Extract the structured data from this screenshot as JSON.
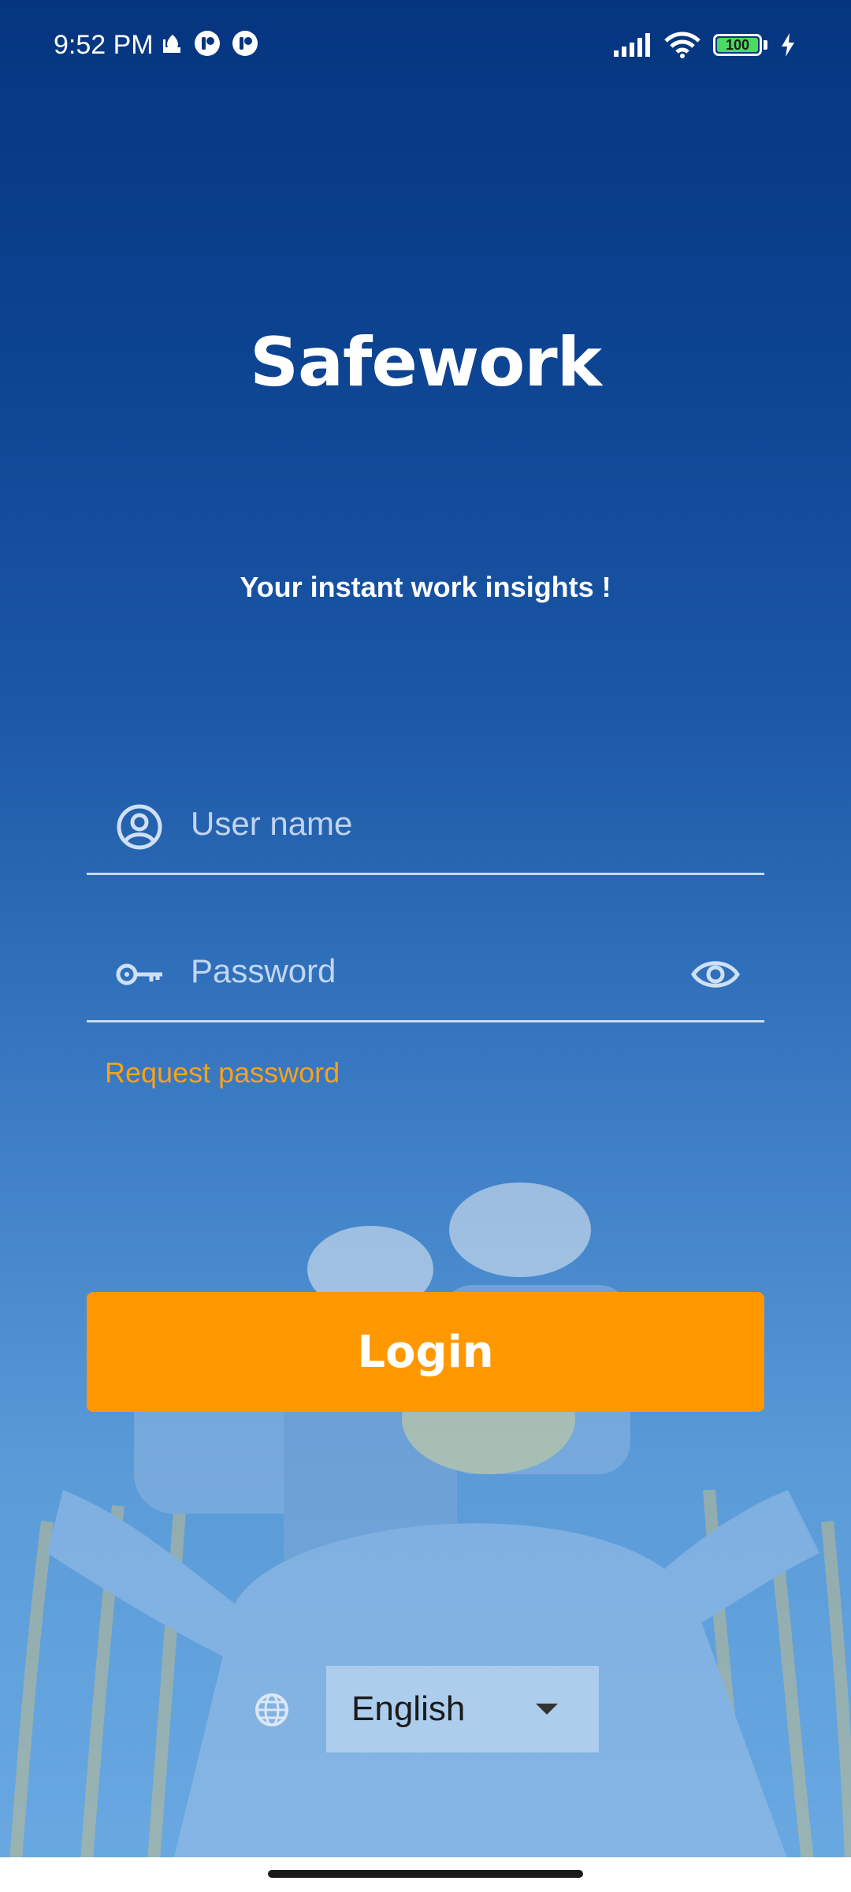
{
  "status_bar": {
    "time": "9:52 PM",
    "battery": "100",
    "icons": [
      "mosque-icon",
      "app-notification-icon",
      "app-notification-icon",
      "signal-icon",
      "wifi-icon",
      "battery-icon",
      "charging-icon"
    ]
  },
  "app": {
    "title": "Safework",
    "tagline": "Your instant work insights !"
  },
  "login_form": {
    "username_placeholder": "User name",
    "username_value": "",
    "password_placeholder": "Password",
    "password_value": "",
    "request_password_label": "Request password",
    "login_label": "Login"
  },
  "language": {
    "selected": "English"
  },
  "colors": {
    "accent": "#ff9800",
    "link": "#f7a21b",
    "background_top": "#05357f",
    "background_bottom": "#6aa9e2"
  }
}
